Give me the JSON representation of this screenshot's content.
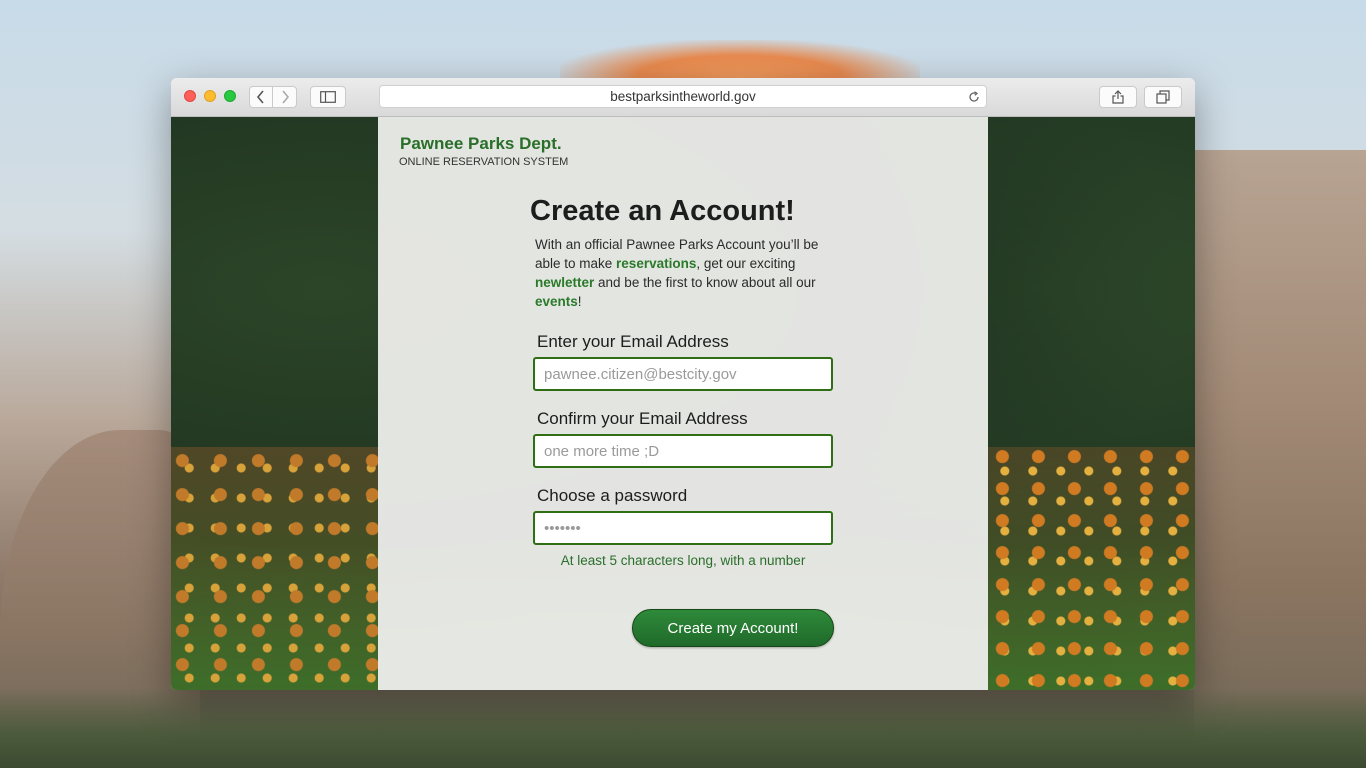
{
  "browser": {
    "url": "bestparksintheworld.gov",
    "back_icon": "chevron-left-icon",
    "forward_icon": "chevron-right-icon",
    "sidebar_icon": "sidebar-icon",
    "reload_icon": "reload-icon",
    "share_icon": "share-icon",
    "tabs_icon": "tabs-icon"
  },
  "brand": {
    "title": "Pawnee Parks Dept.",
    "subtitle": "ONLINE RESERVATION SYSTEM"
  },
  "form": {
    "heading": "Create an Account!",
    "intro": {
      "part1": "With an official Pawnee Parks Account you’ll be able to make ",
      "link1": "reservations",
      "part2": ", get our exciting ",
      "link2": "newletter",
      "part3": " and be the first to know about all our ",
      "link3": "events",
      "part4": "!"
    },
    "email": {
      "label": "Enter your Email Address",
      "placeholder": "pawnee.citizen@bestcity.gov",
      "value": ""
    },
    "confirm_email": {
      "label": "Confirm your Email Address",
      "placeholder": "one more time ;D",
      "value": ""
    },
    "password": {
      "label": "Choose a password",
      "placeholder": "•••••••",
      "value": ""
    },
    "password_hint": "At least 5 characters long, with a number",
    "submit_label": "Create my Account!"
  },
  "colors": {
    "accent_green": "#2a6e2a",
    "input_border": "#2f6e14",
    "button_green": "#1f6a2a"
  }
}
